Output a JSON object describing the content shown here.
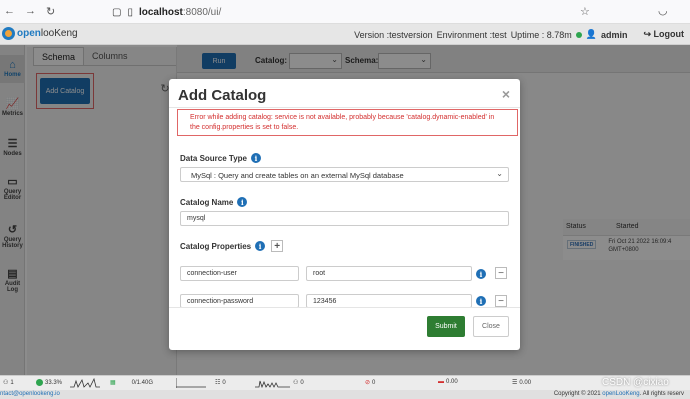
{
  "browser": {
    "url_host": "localhost",
    "url_rest": ":8080/ui/"
  },
  "header": {
    "logo_open": "open",
    "logo_rest": "looKeng",
    "version": "Version :testversion",
    "environment": "Environment :test",
    "uptime": "Uptime : 8.78m",
    "user": "admin",
    "logout": "Logout"
  },
  "sidebar": {
    "items": [
      {
        "label": "Home",
        "icon": "home-icon"
      },
      {
        "label": "Metrics",
        "icon": "chart-icon"
      },
      {
        "label": "Nodes",
        "icon": "server-icon"
      },
      {
        "label": "Query Editor",
        "icon": "monitor-icon"
      },
      {
        "label": "Query History",
        "icon": "history-icon"
      },
      {
        "label": "Audit Log",
        "icon": "document-icon"
      }
    ]
  },
  "left_panel": {
    "tabs": [
      "Schema",
      "Columns"
    ],
    "add_catalog": "Add Catalog"
  },
  "toolbar": {
    "run": "Run",
    "catalog_label": "Catalog:",
    "schema_label": "Schema:"
  },
  "results": {
    "columns": [
      "Status",
      "Started"
    ],
    "status": "FINISHED",
    "started_line1": "Fri Oct 21 2022 16:09:4",
    "started_line2": "GMT+0800"
  },
  "modal": {
    "title": "Add Catalog",
    "close_glyph": "×",
    "error": "Error while adding catalog: service is not available, probably because 'catalog.dynamic-enabled' in the config.properties is set to false.",
    "data_source_label": "Data Source Type",
    "data_source_value": "MySql : Query and create tables on an external MySql database",
    "catalog_name_label": "Catalog Name",
    "catalog_name_value": "mysql",
    "catalog_props_label": "Catalog Properties",
    "properties": [
      {
        "key": "connection-user",
        "value": "root"
      },
      {
        "key": "connection-password",
        "value": "123456"
      }
    ],
    "submit": "Submit",
    "close": "Close"
  },
  "statusbar": {
    "nodes": "1",
    "cpu": "33.3%",
    "memory": "0/1.40G",
    "queued": "0",
    "running": "0",
    "blocked": "0",
    "rate1": "0.00",
    "rate2": "0.00"
  },
  "footer": {
    "contact": "ntact@openlookeng.io",
    "copyright_prefix": "Copyright © 2021 ",
    "copyright_brand": "openLooKeng",
    "copyright_suffix": ". All rights reserv"
  },
  "watermark": "CSDN @cixiao",
  "colors": {
    "primary": "#1f6fb5",
    "success": "#2e7d32",
    "error": "#d32f2f"
  }
}
